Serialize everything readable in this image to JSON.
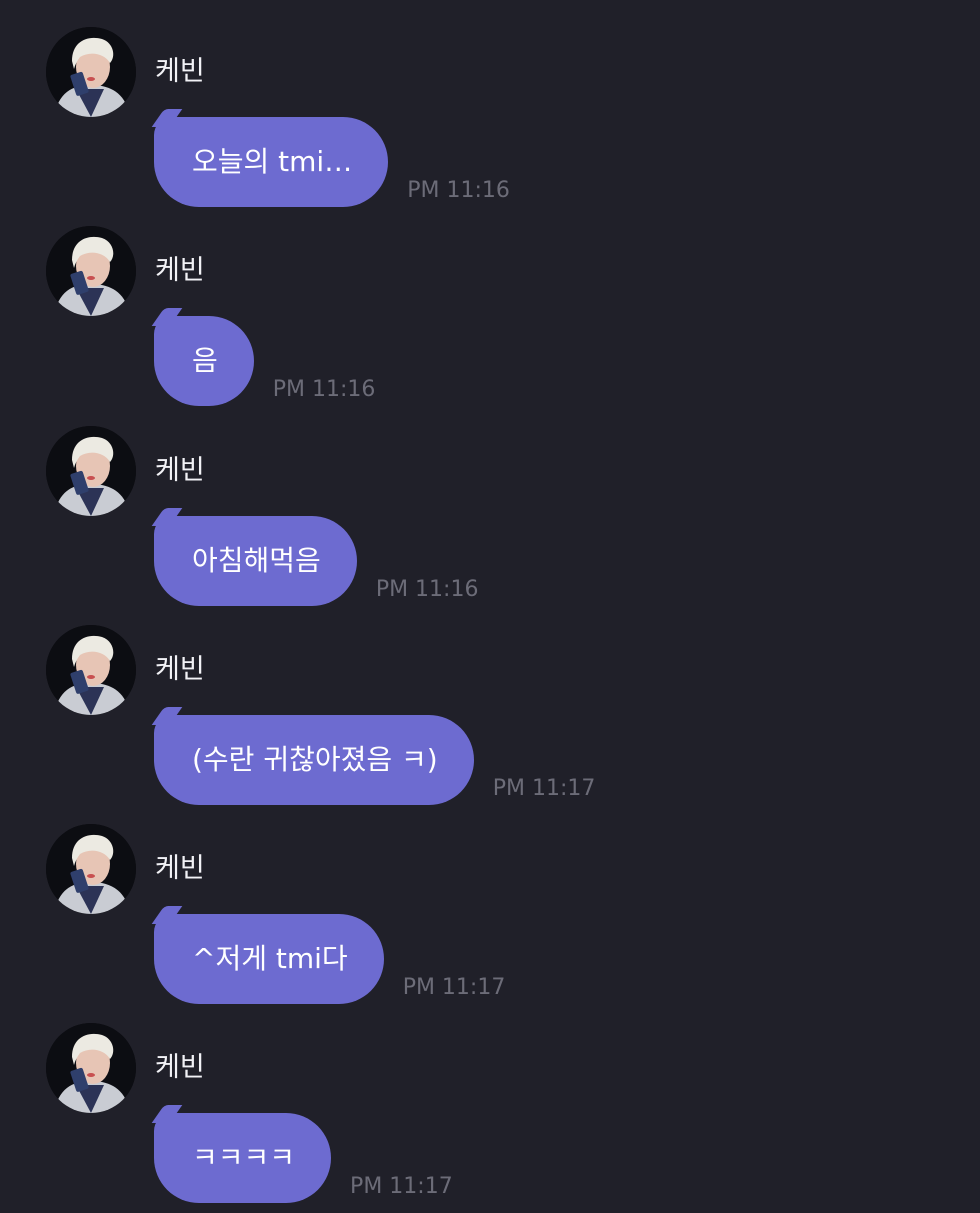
{
  "messages": [
    {
      "sender": "케빈",
      "text": "오늘의 tmi…",
      "time": "PM 11:16"
    },
    {
      "sender": "케빈",
      "text": "음",
      "time": "PM 11:16"
    },
    {
      "sender": "케빈",
      "text": "아침해먹음",
      "time": "PM 11:16"
    },
    {
      "sender": "케빈",
      "text": "(수란 귀찮아졌음 ㅋ)",
      "time": "PM 11:17"
    },
    {
      "sender": "케빈",
      "text": "^저게 tmi다",
      "time": "PM 11:17"
    },
    {
      "sender": "케빈",
      "text": "ㅋㅋㅋㅋ",
      "time": "PM 11:17"
    }
  ],
  "colors": {
    "background": "#202029",
    "bubble": "#6d6bd0",
    "timestamp": "#6c6c78"
  },
  "icons": {
    "avatar": "profile-photo"
  }
}
